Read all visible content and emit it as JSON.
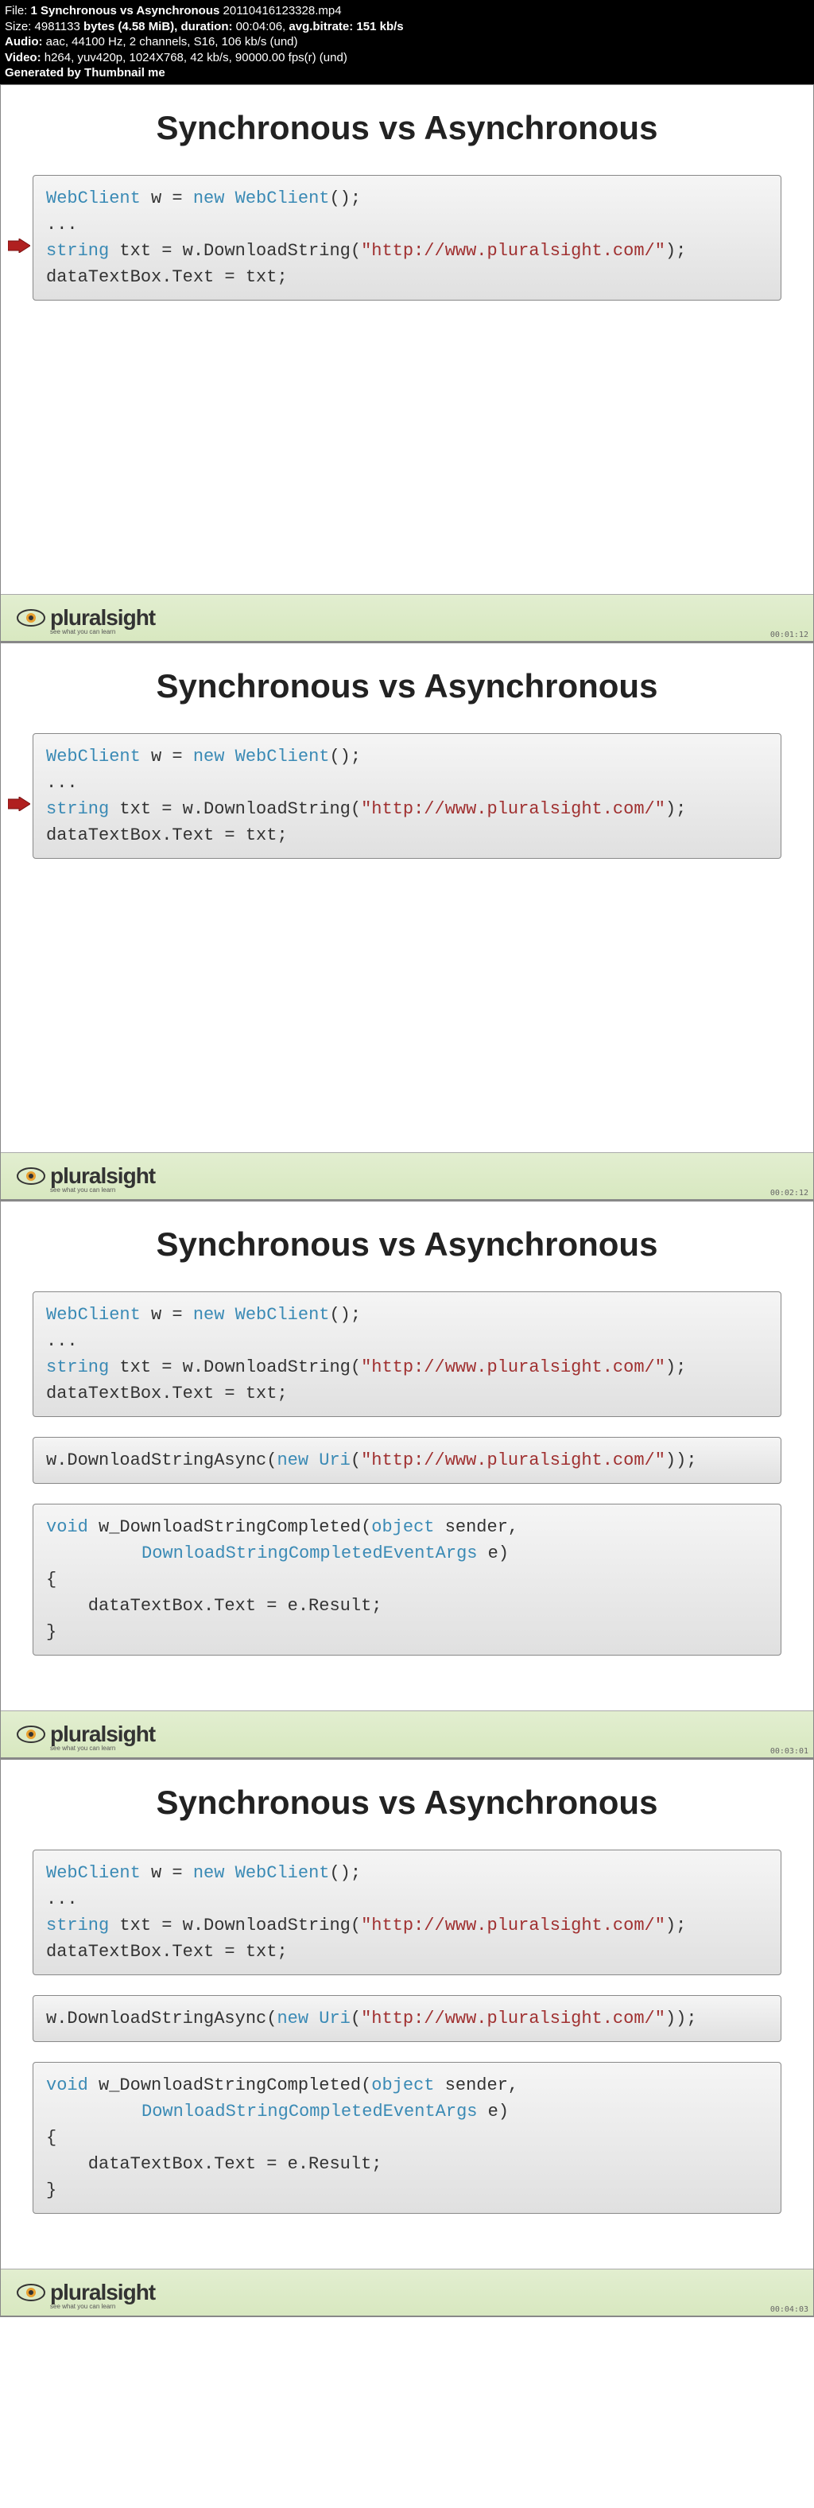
{
  "file_header": {
    "line1_prefix": "File: ",
    "line1_bold": "1 Synchronous vs Asynchronous",
    "line1_suffix": " 20110416123328.mp4",
    "line2_prefix": "Size: ",
    "line2_size": "4981133",
    "line2_mid": " bytes (4.58 MiB), duration: ",
    "line2_dur": "00:04:06,",
    "line2_end": " avg.bitrate: ",
    "line2_bitrate": "151 kb/s",
    "line3_prefix": "Audio: ",
    "line3_val": "aac, 44100 Hz, 2 channels, S16, 106 kb/s (und)",
    "line4_prefix": "Video: ",
    "line4_val": "h264, yuv420p, 1024X768, 42 kb/s, 90000.00 fps(r) (und)",
    "line5": "Generated by Thumbnail me"
  },
  "slides": {
    "title": "Synchronous vs Asynchronous",
    "code1": {
      "l1_a": "WebClient",
      "l1_b": " w = ",
      "l1_c": "new",
      "l1_d": " WebClient",
      "l1_e": "();",
      "l2": "...",
      "l3_a": "string",
      "l3_b": " txt = w.DownloadString(",
      "l3_c": "\"http://www.pluralsight.com/\"",
      "l3_d": ");",
      "l4": "dataTextBox.Text = txt;"
    },
    "code2": {
      "l1_a": "w.DownloadStringAsync(",
      "l1_b": "new",
      "l1_c": " Uri",
      "l1_d": "(",
      "l1_e": "\"http://www.pluralsight.com/\"",
      "l1_f": "));"
    },
    "code3": {
      "l1_a": "void",
      "l1_b": " w_DownloadStringCompleted(",
      "l1_c": "object",
      "l1_d": " sender,",
      "l2_a": "DownloadStringCompletedEventArgs",
      "l2_b": " e)",
      "l3": "{",
      "l4": "    dataTextBox.Text = e.Result;",
      "l5": "}"
    },
    "footer": {
      "logo": "pluralsight",
      "tag": "see what you can learn",
      "ts1": "00:01:12",
      "ts2": "00:02:12",
      "ts3": "00:03:01",
      "ts4": "00:04:03"
    }
  }
}
